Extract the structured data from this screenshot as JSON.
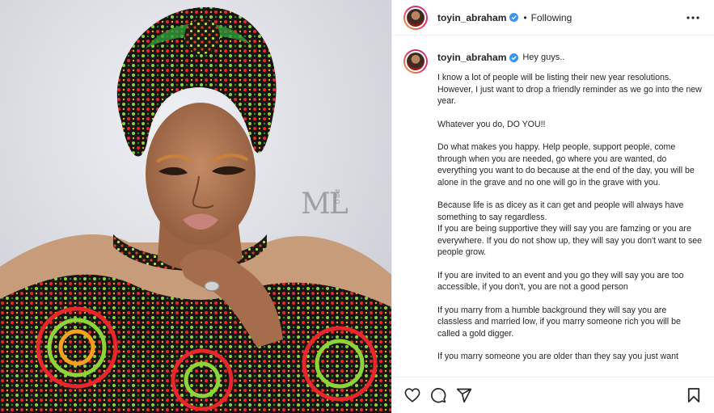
{
  "post": {
    "username": "toyin_abraham",
    "follow_status": "Following",
    "separator": "•",
    "watermark": "ML",
    "watermark_sub": "PRO"
  },
  "caption": {
    "username": "toyin_abraham",
    "greeting": "Hey guys..",
    "paragraphs": [
      "I know a lot of people will be listing their new year resolutions. However, I just want to drop a friendly reminder as we go into the new year.",
      "Whatever you do, DO YOU!!",
      "Do what makes you happy. Help people, support people, come through when you are needed, go where you are wanted, do everything you want to do because at the end of the day, you will be alone in the grave and no one will go in the grave with you.",
      "Because life is as dicey as it can get and people will always have something to say regardless.",
      "If you are being supportive they will say you are famzing or you are everywhere. If you do not show up, they will say you don't want to see people grow.",
      "If you are invited to an event and you go they will say you are too accessible, if you don't, you are not a good person",
      "If you marry from a humble background they will say you are classless and married low, if you marry someone rich you will be called a gold digger.",
      "If you marry someone you are older than they say you just want"
    ]
  },
  "icons": {
    "more": "more-options-icon",
    "verified": "verified-badge-icon",
    "like": "heart-icon",
    "comment": "comment-icon",
    "share": "share-icon",
    "save": "bookmark-icon"
  },
  "colors": {
    "verified": "#3897f0",
    "text": "#262626",
    "border": "#efefef"
  }
}
